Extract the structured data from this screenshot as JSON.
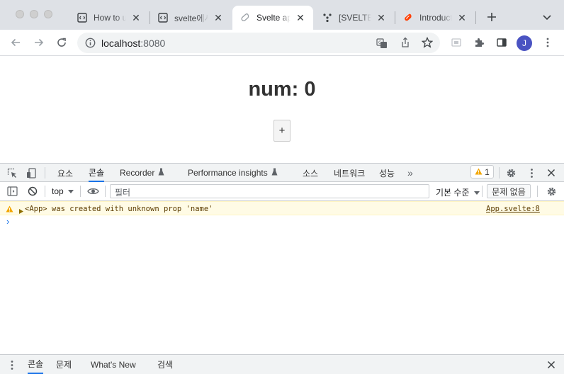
{
  "tabs": [
    {
      "label": "How to u",
      "icon": "code-file-icon"
    },
    {
      "label": "svelte에서",
      "icon": "code-file-icon"
    },
    {
      "label": "Svelte ap",
      "icon": "svelte-icon",
      "active": true
    },
    {
      "label": "[SVELTE]",
      "icon": "velog-icon"
    },
    {
      "label": "Introduct",
      "icon": "svelte-red-icon"
    }
  ],
  "toolbar": {
    "url_host": "localhost",
    "url_port": ":8080",
    "avatar_letter": "J"
  },
  "page": {
    "heading": "num: 0",
    "plus_label": "+"
  },
  "devtools": {
    "tabs": [
      "요소",
      "콘솔",
      "Recorder",
      "Performance insights",
      "소스",
      "네트워크",
      "성능"
    ],
    "more": "»",
    "warning_count": "1",
    "context": "top",
    "filter_placeholder": "필터",
    "levels": "기본 수준",
    "issues": "문제 없음",
    "warning_message": "<App> was created with unknown prop 'name'",
    "warning_source": "App.svelte:8",
    "prompt": "›",
    "drawer_tabs": [
      "콘솔",
      "문제",
      "What's New",
      "검색"
    ]
  },
  "colors": {
    "accent": "#1a73e8",
    "warning_bg": "#fffbe5",
    "warning_icon": "#f2a600",
    "avatar": "#4a53c2"
  }
}
